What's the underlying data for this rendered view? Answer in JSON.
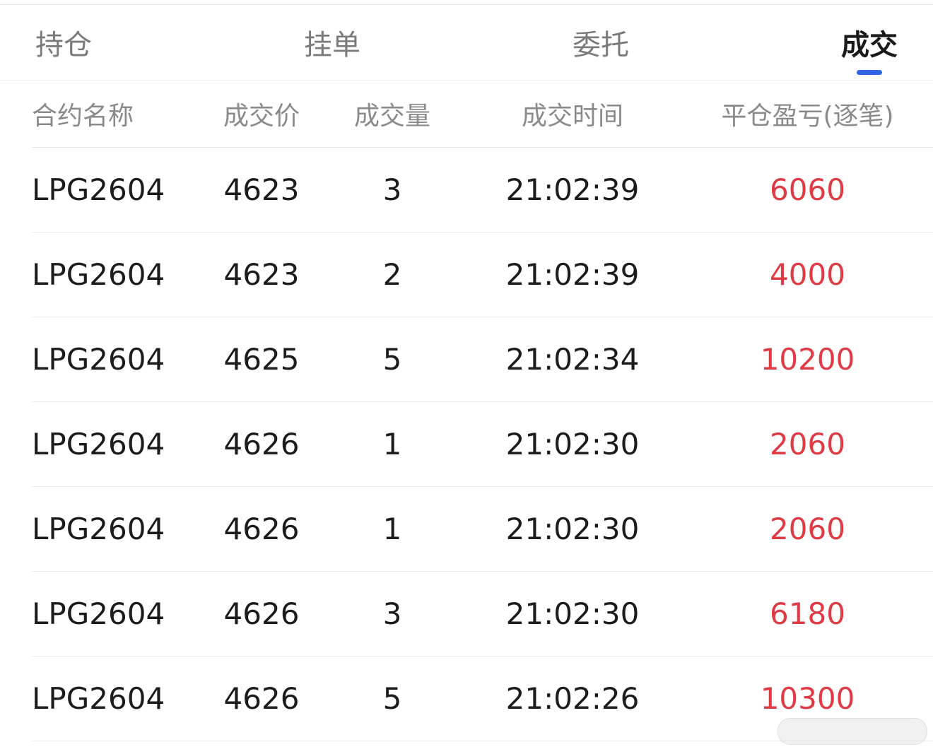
{
  "tabs": [
    {
      "label": "持仓"
    },
    {
      "label": "挂单"
    },
    {
      "label": "委托"
    },
    {
      "label": "成交"
    }
  ],
  "active_tab": "成交",
  "table": {
    "headers": {
      "name": "合约名称",
      "price": "成交价",
      "volume": "成交量",
      "time": "成交时间",
      "pnl": "平仓盈亏(逐笔)"
    },
    "rows": [
      {
        "name": "LPG2604",
        "price": "4623",
        "volume": "3",
        "time": "21:02:39",
        "pnl": "6060"
      },
      {
        "name": "LPG2604",
        "price": "4623",
        "volume": "2",
        "time": "21:02:39",
        "pnl": "4000"
      },
      {
        "name": "LPG2604",
        "price": "4625",
        "volume": "5",
        "time": "21:02:34",
        "pnl": "10200"
      },
      {
        "name": "LPG2604",
        "price": "4626",
        "volume": "1",
        "time": "21:02:30",
        "pnl": "2060"
      },
      {
        "name": "LPG2604",
        "price": "4626",
        "volume": "1",
        "time": "21:02:30",
        "pnl": "2060"
      },
      {
        "name": "LPG2604",
        "price": "4626",
        "volume": "3",
        "time": "21:02:30",
        "pnl": "6180"
      },
      {
        "name": "LPG2604",
        "price": "4626",
        "volume": "5",
        "time": "21:02:26",
        "pnl": "10300"
      }
    ]
  },
  "colors": {
    "accent": "#3366e6",
    "profit": "#e03a45"
  }
}
